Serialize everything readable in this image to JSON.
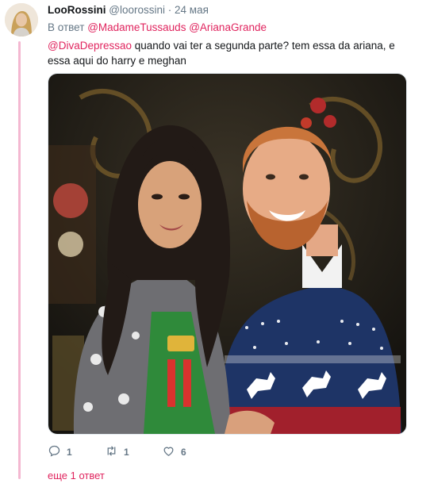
{
  "tweet": {
    "author_name": "LooRossini",
    "author_handle": "@loorossini",
    "separator": "·",
    "timestamp": "24 мая",
    "reply_prefix": "В ответ",
    "reply_mentions": [
      "@MadameTussauds",
      "@ArianaGrande"
    ],
    "text_mention": "@DivaDepressao",
    "text_body": " quando vai ter a segunda parte? tem essa da ariana, e essa aqui do harry e meghan",
    "actions": {
      "reply_count": "1",
      "retweet_count": "1",
      "like_count": "6"
    }
  },
  "more_replies": "еще 1 ответ",
  "colors": {
    "accent": "#e0245e",
    "thread_line": "#f4b8d1",
    "secondary_text": "#657786"
  },
  "icons": [
    "reply-icon",
    "retweet-icon",
    "heart-icon"
  ]
}
